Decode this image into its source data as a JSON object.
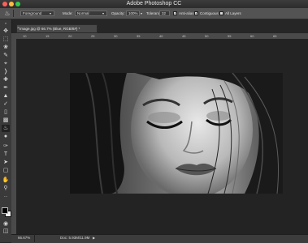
{
  "app": {
    "title": "Adobe Photoshop CC"
  },
  "colors": {
    "close": "#fc605c",
    "minimize": "#fdbc40",
    "zoom": "#34c84a"
  },
  "options_bar": {
    "tool_icon": "paint-bucket-icon",
    "fill_source": "Foreground",
    "mode_label": "Mode:",
    "mode_value": "Normal",
    "opacity_label": "Opacity:",
    "opacity_value": "100%",
    "tolerance_label": "Tolerance:",
    "tolerance_value": "32",
    "anti_alias_label": "Anti-alias",
    "contiguous_label": "Contiguous",
    "all_layers_label": "All Layers"
  },
  "document": {
    "tab_title": "Image.jpg @ 66.7% (Blue, RGB/8#) *",
    "close_glyph": "×"
  },
  "rulers": {
    "horizontal": [
      "10",
      "15",
      "20",
      "25",
      "30",
      "35",
      "40",
      "45",
      "50",
      "55",
      "60",
      "65"
    ]
  },
  "status": {
    "zoom": "66.67%",
    "doc_size": "Doc: 5.93M/11.9M"
  }
}
